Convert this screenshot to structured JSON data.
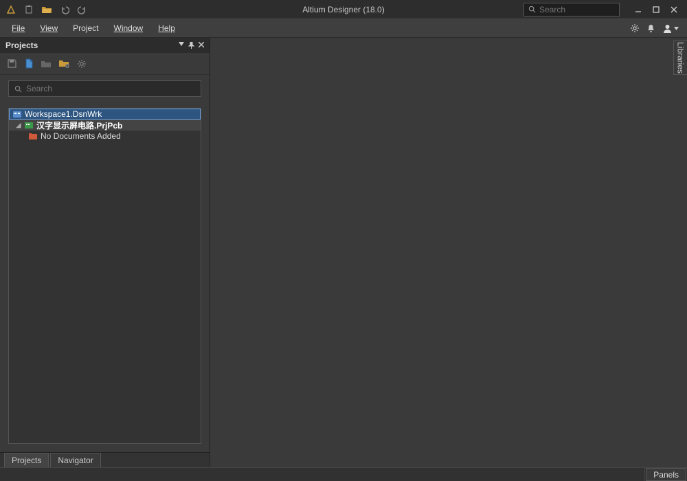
{
  "titlebar": {
    "title": "Altium Designer (18.0)"
  },
  "search": {
    "placeholder": "Search"
  },
  "menu": {
    "file": "File",
    "view": "View",
    "project": "Project",
    "window": "Window",
    "help": "Help"
  },
  "panel": {
    "title": "Projects",
    "search_placeholder": "Search",
    "tabs": {
      "projects": "Projects",
      "navigator": "Navigator"
    }
  },
  "tree": {
    "workspace": "Workspace1.DsnWrk",
    "project": "汉字显示屏电路.PrjPcb",
    "empty": "No Documents Added"
  },
  "libraries_tab": "Libraries",
  "statusbar": {
    "panels": "Panels"
  }
}
